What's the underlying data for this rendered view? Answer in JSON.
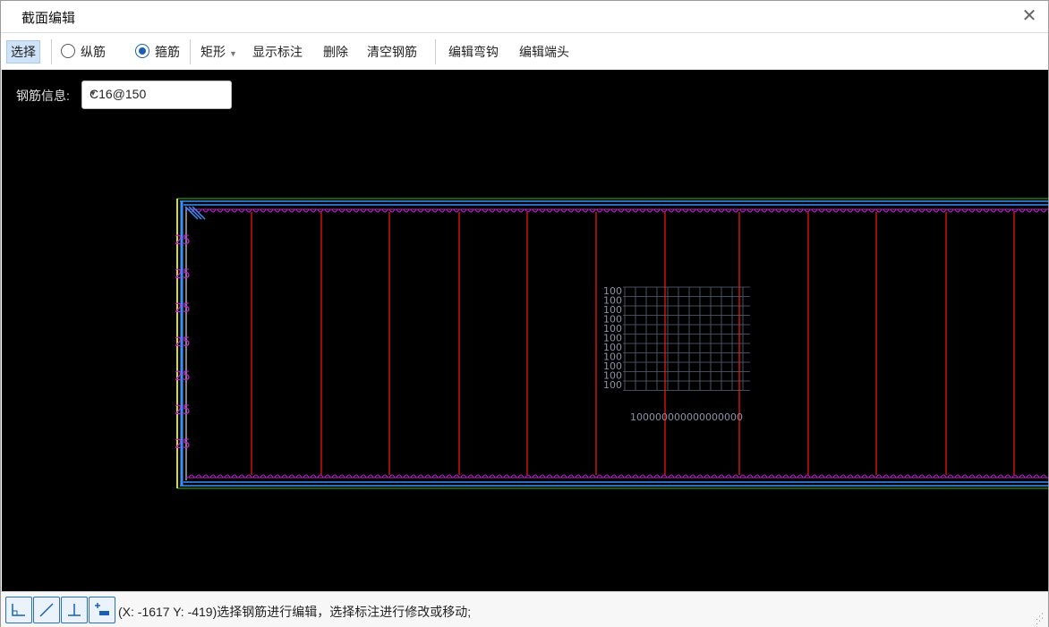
{
  "window": {
    "title": "截面编辑"
  },
  "toolbar": {
    "select": "选择",
    "longitudinal": "纵筋",
    "stirrup": "箍筋",
    "shape": "矩形",
    "show_annotation": "显示标注",
    "delete": "删除",
    "clear_rebar": "清空钢筋",
    "edit_hook": "编辑弯钩",
    "edit_end": "编辑端头"
  },
  "radio_selected": "stirrup",
  "rebar_info": {
    "label": "钢筋信息:",
    "value": "C16@150"
  },
  "canvas_labels": {
    "left_marks": [
      "25",
      "25",
      "25",
      "25",
      "25",
      "25",
      "25"
    ],
    "table_rows": [
      "100",
      "100",
      "100",
      "100",
      "100",
      "100",
      "100",
      "100",
      "100",
      "100",
      "100"
    ],
    "table_footer": "100000000000000000"
  },
  "status": {
    "text": "(X: -1617 Y: -419)选择钢筋进行编辑，选择标注进行修改或移动;"
  },
  "status_buttons": [
    "ortho-snap-icon",
    "line-snap-icon",
    "perpendicular-snap-icon",
    "add-point-icon"
  ],
  "colors": {
    "stirrup": "#d01010",
    "frame": "#3a8fff",
    "hooks": "#c020d0",
    "dim": "#20c020",
    "accent": "#1a5fb4"
  }
}
